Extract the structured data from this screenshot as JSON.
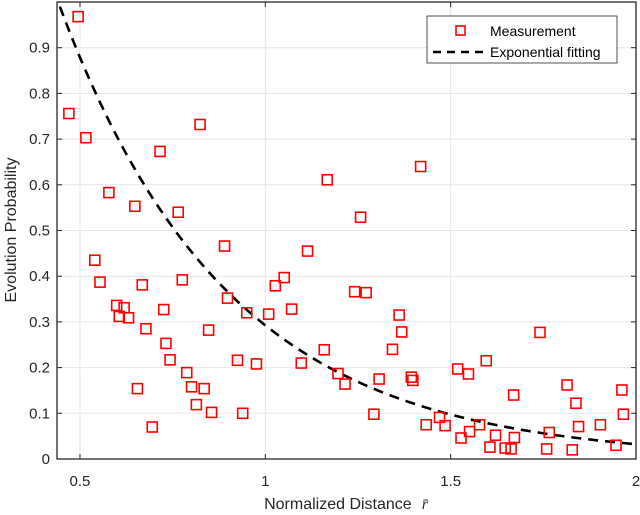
{
  "chart_data": {
    "type": "scatter",
    "title": "",
    "xlabel": "Normalized Distance",
    "xlabel_symbol": "r̄",
    "ylabel": "Evolution Probability",
    "xlim": [
      0.438,
      2.0
    ],
    "ylim": [
      0,
      1.0
    ],
    "x_ticks": [
      0.5,
      1,
      1.5,
      2
    ],
    "x_tick_labels": [
      "0.5",
      "1",
      "1.5",
      "2"
    ],
    "y_ticks": [
      0,
      0.1,
      0.2,
      0.3,
      0.4,
      0.5,
      0.6,
      0.7,
      0.8,
      0.9
    ],
    "y_tick_labels": [
      "0",
      "0.1",
      "0.2",
      "0.3",
      "0.4",
      "0.5",
      "0.6",
      "0.7",
      "0.8",
      "0.9"
    ],
    "grid": true,
    "legend_position": "top-right",
    "colors": {
      "measurement": "#ff0000",
      "fit": "#000000",
      "grid": "#e6e6e6",
      "axis": "#262626"
    },
    "series": [
      {
        "name": "Measurement",
        "kind": "marker-square",
        "points": [
          [
            0.495,
            0.968
          ],
          [
            0.47,
            0.756
          ],
          [
            0.516,
            0.703
          ],
          [
            0.824,
            0.732
          ],
          [
            0.716,
            0.673
          ],
          [
            0.578,
            0.583
          ],
          [
            0.648,
            0.553
          ],
          [
            0.765,
            0.54
          ],
          [
            0.89,
            0.466
          ],
          [
            0.54,
            0.435
          ],
          [
            0.554,
            0.387
          ],
          [
            0.668,
            0.381
          ],
          [
            0.776,
            0.392
          ],
          [
            0.599,
            0.336
          ],
          [
            0.619,
            0.331
          ],
          [
            0.606,
            0.312
          ],
          [
            0.631,
            0.309
          ],
          [
            0.726,
            0.327
          ],
          [
            0.678,
            0.285
          ],
          [
            0.847,
            0.282
          ],
          [
            0.732,
            0.253
          ],
          [
            0.743,
            0.217
          ],
          [
            0.925,
            0.216
          ],
          [
            0.788,
            0.189
          ],
          [
            0.655,
            0.154
          ],
          [
            0.801,
            0.158
          ],
          [
            0.835,
            0.154
          ],
          [
            0.814,
            0.119
          ],
          [
            0.855,
            0.102
          ],
          [
            0.939,
            0.1
          ],
          [
            0.695,
            0.07
          ],
          [
            0.898,
            0.352
          ],
          [
            0.95,
            0.32
          ],
          [
            1.419,
            0.64
          ],
          [
            1.167,
            0.611
          ],
          [
            1.257,
            0.529
          ],
          [
            1.114,
            0.455
          ],
          [
            1.051,
            0.397
          ],
          [
            1.027,
            0.379
          ],
          [
            1.241,
            0.366
          ],
          [
            1.272,
            0.364
          ],
          [
            1.071,
            0.328
          ],
          [
            1.009,
            0.317
          ],
          [
            1.361,
            0.315
          ],
          [
            1.368,
            0.278
          ],
          [
            1.343,
            0.24
          ],
          [
            1.159,
            0.239
          ],
          [
            1.097,
            0.21
          ],
          [
            0.976,
            0.208
          ],
          [
            1.196,
            0.187
          ],
          [
            1.215,
            0.164
          ],
          [
            1.307,
            0.175
          ],
          [
            1.394,
            0.179
          ],
          [
            1.398,
            0.172
          ],
          [
            1.293,
            0.098
          ],
          [
            1.434,
            0.075
          ],
          [
            1.47,
            0.091
          ],
          [
            1.741,
            0.277
          ],
          [
            1.519,
            0.197
          ],
          [
            1.548,
            0.186
          ],
          [
            1.596,
            0.215
          ],
          [
            1.67,
            0.14
          ],
          [
            1.814,
            0.162
          ],
          [
            1.838,
            0.122
          ],
          [
            1.962,
            0.151
          ],
          [
            1.966,
            0.098
          ],
          [
            1.485,
            0.073
          ],
          [
            1.528,
            0.046
          ],
          [
            1.551,
            0.06
          ],
          [
            1.578,
            0.075
          ],
          [
            1.621,
            0.052
          ],
          [
            1.606,
            0.026
          ],
          [
            1.647,
            0.024
          ],
          [
            1.663,
            0.022
          ],
          [
            1.672,
            0.047
          ],
          [
            1.766,
            0.058
          ],
          [
            1.759,
            0.022
          ],
          [
            1.845,
            0.071
          ],
          [
            1.904,
            0.075
          ],
          [
            1.828,
            0.02
          ],
          [
            1.946,
            0.03
          ]
        ]
      },
      {
        "name": "Exponential fitting",
        "kind": "dashed-line",
        "model": "y = a * exp(-b * x)",
        "a": 2.64,
        "b": 2.2,
        "x_range": [
          0.438,
          2.0
        ]
      }
    ],
    "legend": [
      "Measurement",
      "Exponential fitting"
    ]
  }
}
